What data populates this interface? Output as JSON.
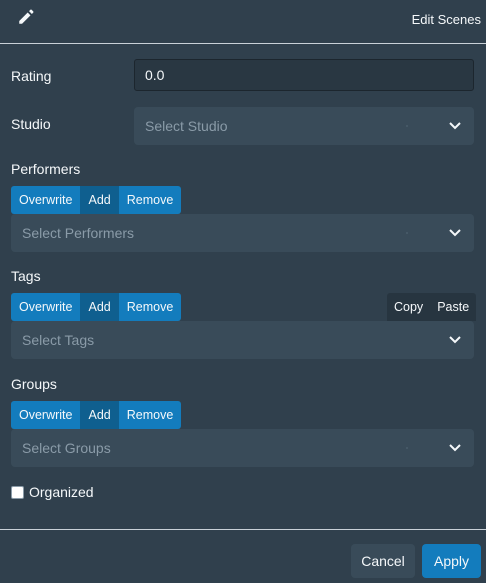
{
  "header": {
    "title": "Edit Scenes",
    "icon": "pencil-icon"
  },
  "rating": {
    "label": "Rating",
    "value": "0.0"
  },
  "studio": {
    "label": "Studio",
    "placeholder": "Select Studio"
  },
  "performers": {
    "label": "Performers",
    "modes": [
      "Overwrite",
      "Add",
      "Remove"
    ],
    "selected_mode": "Add",
    "placeholder": "Select Performers"
  },
  "tags": {
    "label": "Tags",
    "modes": [
      "Overwrite",
      "Add",
      "Remove"
    ],
    "selected_mode": "Add",
    "placeholder": "Select Tags",
    "copy_label": "Copy",
    "paste_label": "Paste"
  },
  "groups": {
    "label": "Groups",
    "modes": [
      "Overwrite",
      "Add",
      "Remove"
    ],
    "selected_mode": "Add",
    "placeholder": "Select Groups"
  },
  "organized": {
    "label": "Organized",
    "checked": false
  },
  "footer": {
    "cancel_label": "Cancel",
    "apply_label": "Apply"
  },
  "colors": {
    "background": "#30404d",
    "primary": "#137cbd",
    "input": "#394b59"
  }
}
